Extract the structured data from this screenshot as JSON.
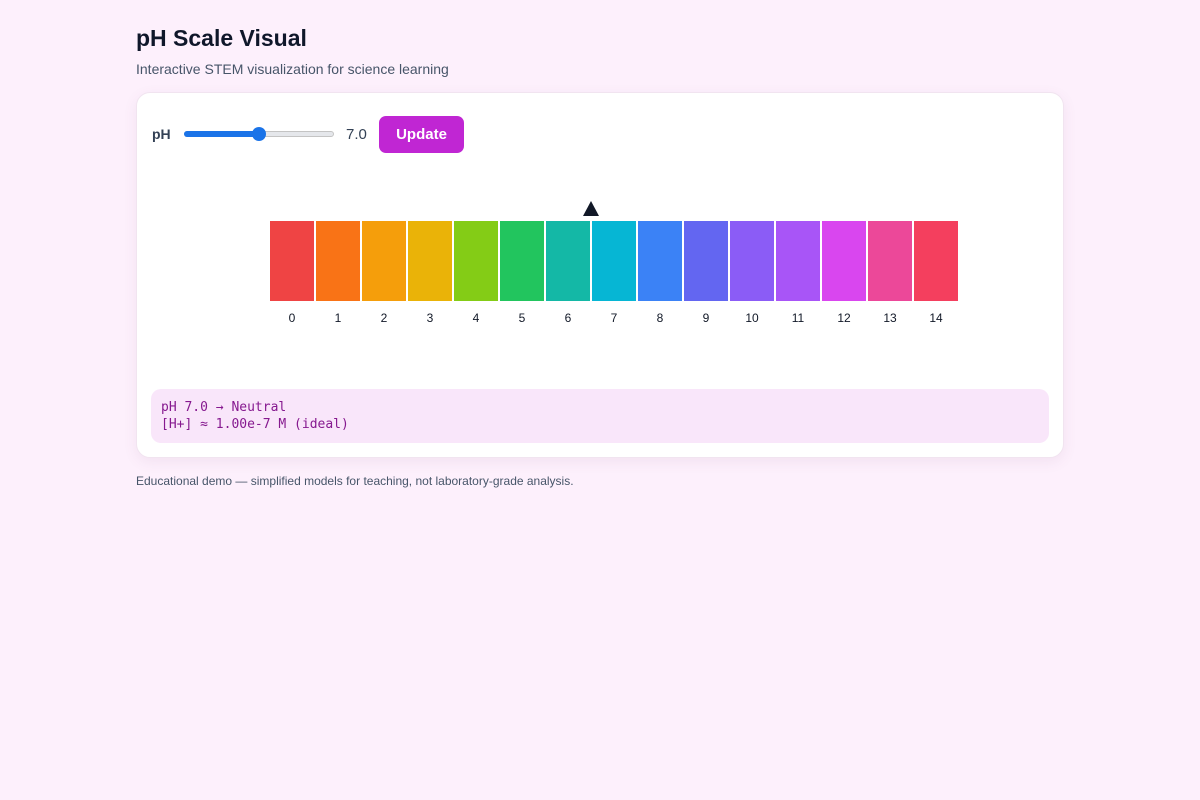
{
  "header": {
    "title": "pH Scale Visual",
    "subtitle": "Interactive STEM visualization for science learning"
  },
  "controls": {
    "label": "pH",
    "value": 7,
    "min": 0,
    "max": 14,
    "value_text": "7.0",
    "update_label": "Update"
  },
  "scale": {
    "segments": [
      {
        "ph": "0",
        "color": "#ef4444"
      },
      {
        "ph": "1",
        "color": "#f97316"
      },
      {
        "ph": "2",
        "color": "#f59e0b"
      },
      {
        "ph": "3",
        "color": "#eab308"
      },
      {
        "ph": "4",
        "color": "#84cc16"
      },
      {
        "ph": "5",
        "color": "#22c55e"
      },
      {
        "ph": "6",
        "color": "#14b8a6"
      },
      {
        "ph": "7",
        "color": "#06b6d4"
      },
      {
        "ph": "8",
        "color": "#3b82f6"
      },
      {
        "ph": "9",
        "color": "#6366f1"
      },
      {
        "ph": "10",
        "color": "#8b5cf6"
      },
      {
        "ph": "11",
        "color": "#a855f7"
      },
      {
        "ph": "12",
        "color": "#d946ef"
      },
      {
        "ph": "13",
        "color": "#ec4899"
      },
      {
        "ph": "14",
        "color": "#f43f5e"
      }
    ],
    "marker_value": 7
  },
  "readout": {
    "line1": "pH 7.0 → Neutral",
    "line2": "[H+] ≈ 1.00e-7 M (ideal)"
  },
  "footer": {
    "note": "Educational demo — simplified models for teaching, not laboratory-grade analysis."
  },
  "colors": {
    "accent": "#c026d3",
    "slider": "#1a73e8",
    "background": "#fdf0fc"
  }
}
